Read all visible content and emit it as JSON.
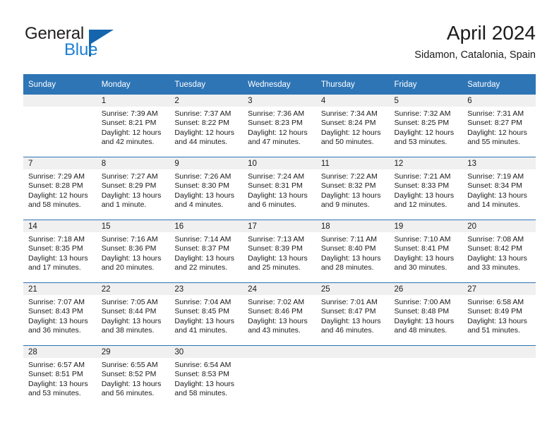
{
  "brand": {
    "name_part1": "General",
    "name_part2": "Blue",
    "logo_icon": "triangle-flag-icon"
  },
  "header": {
    "month_title": "April 2024",
    "location": "Sidamon, Catalonia, Spain"
  },
  "colors": {
    "header_blue": "#2e75b6",
    "brand_blue": "#1c7fd4",
    "daynum_band": "#f0f0f0"
  },
  "weekday_headers": [
    "Sunday",
    "Monday",
    "Tuesday",
    "Wednesday",
    "Thursday",
    "Friday",
    "Saturday"
  ],
  "weeks": [
    [
      {
        "day": "",
        "empty": true,
        "l1": "",
        "l2": "",
        "l3": "",
        "l4": ""
      },
      {
        "day": "1",
        "l1": "Sunrise: 7:39 AM",
        "l2": "Sunset: 8:21 PM",
        "l3": "Daylight: 12 hours",
        "l4": "and 42 minutes."
      },
      {
        "day": "2",
        "l1": "Sunrise: 7:37 AM",
        "l2": "Sunset: 8:22 PM",
        "l3": "Daylight: 12 hours",
        "l4": "and 44 minutes."
      },
      {
        "day": "3",
        "l1": "Sunrise: 7:36 AM",
        "l2": "Sunset: 8:23 PM",
        "l3": "Daylight: 12 hours",
        "l4": "and 47 minutes."
      },
      {
        "day": "4",
        "l1": "Sunrise: 7:34 AM",
        "l2": "Sunset: 8:24 PM",
        "l3": "Daylight: 12 hours",
        "l4": "and 50 minutes."
      },
      {
        "day": "5",
        "l1": "Sunrise: 7:32 AM",
        "l2": "Sunset: 8:25 PM",
        "l3": "Daylight: 12 hours",
        "l4": "and 53 minutes."
      },
      {
        "day": "6",
        "l1": "Sunrise: 7:31 AM",
        "l2": "Sunset: 8:27 PM",
        "l3": "Daylight: 12 hours",
        "l4": "and 55 minutes."
      }
    ],
    [
      {
        "day": "7",
        "l1": "Sunrise: 7:29 AM",
        "l2": "Sunset: 8:28 PM",
        "l3": "Daylight: 12 hours",
        "l4": "and 58 minutes."
      },
      {
        "day": "8",
        "l1": "Sunrise: 7:27 AM",
        "l2": "Sunset: 8:29 PM",
        "l3": "Daylight: 13 hours",
        "l4": "and 1 minute."
      },
      {
        "day": "9",
        "l1": "Sunrise: 7:26 AM",
        "l2": "Sunset: 8:30 PM",
        "l3": "Daylight: 13 hours",
        "l4": "and 4 minutes."
      },
      {
        "day": "10",
        "l1": "Sunrise: 7:24 AM",
        "l2": "Sunset: 8:31 PM",
        "l3": "Daylight: 13 hours",
        "l4": "and 6 minutes."
      },
      {
        "day": "11",
        "l1": "Sunrise: 7:22 AM",
        "l2": "Sunset: 8:32 PM",
        "l3": "Daylight: 13 hours",
        "l4": "and 9 minutes."
      },
      {
        "day": "12",
        "l1": "Sunrise: 7:21 AM",
        "l2": "Sunset: 8:33 PM",
        "l3": "Daylight: 13 hours",
        "l4": "and 12 minutes."
      },
      {
        "day": "13",
        "l1": "Sunrise: 7:19 AM",
        "l2": "Sunset: 8:34 PM",
        "l3": "Daylight: 13 hours",
        "l4": "and 14 minutes."
      }
    ],
    [
      {
        "day": "14",
        "l1": "Sunrise: 7:18 AM",
        "l2": "Sunset: 8:35 PM",
        "l3": "Daylight: 13 hours",
        "l4": "and 17 minutes."
      },
      {
        "day": "15",
        "l1": "Sunrise: 7:16 AM",
        "l2": "Sunset: 8:36 PM",
        "l3": "Daylight: 13 hours",
        "l4": "and 20 minutes."
      },
      {
        "day": "16",
        "l1": "Sunrise: 7:14 AM",
        "l2": "Sunset: 8:37 PM",
        "l3": "Daylight: 13 hours",
        "l4": "and 22 minutes."
      },
      {
        "day": "17",
        "l1": "Sunrise: 7:13 AM",
        "l2": "Sunset: 8:39 PM",
        "l3": "Daylight: 13 hours",
        "l4": "and 25 minutes."
      },
      {
        "day": "18",
        "l1": "Sunrise: 7:11 AM",
        "l2": "Sunset: 8:40 PM",
        "l3": "Daylight: 13 hours",
        "l4": "and 28 minutes."
      },
      {
        "day": "19",
        "l1": "Sunrise: 7:10 AM",
        "l2": "Sunset: 8:41 PM",
        "l3": "Daylight: 13 hours",
        "l4": "and 30 minutes."
      },
      {
        "day": "20",
        "l1": "Sunrise: 7:08 AM",
        "l2": "Sunset: 8:42 PM",
        "l3": "Daylight: 13 hours",
        "l4": "and 33 minutes."
      }
    ],
    [
      {
        "day": "21",
        "l1": "Sunrise: 7:07 AM",
        "l2": "Sunset: 8:43 PM",
        "l3": "Daylight: 13 hours",
        "l4": "and 36 minutes."
      },
      {
        "day": "22",
        "l1": "Sunrise: 7:05 AM",
        "l2": "Sunset: 8:44 PM",
        "l3": "Daylight: 13 hours",
        "l4": "and 38 minutes."
      },
      {
        "day": "23",
        "l1": "Sunrise: 7:04 AM",
        "l2": "Sunset: 8:45 PM",
        "l3": "Daylight: 13 hours",
        "l4": "and 41 minutes."
      },
      {
        "day": "24",
        "l1": "Sunrise: 7:02 AM",
        "l2": "Sunset: 8:46 PM",
        "l3": "Daylight: 13 hours",
        "l4": "and 43 minutes."
      },
      {
        "day": "25",
        "l1": "Sunrise: 7:01 AM",
        "l2": "Sunset: 8:47 PM",
        "l3": "Daylight: 13 hours",
        "l4": "and 46 minutes."
      },
      {
        "day": "26",
        "l1": "Sunrise: 7:00 AM",
        "l2": "Sunset: 8:48 PM",
        "l3": "Daylight: 13 hours",
        "l4": "and 48 minutes."
      },
      {
        "day": "27",
        "l1": "Sunrise: 6:58 AM",
        "l2": "Sunset: 8:49 PM",
        "l3": "Daylight: 13 hours",
        "l4": "and 51 minutes."
      }
    ],
    [
      {
        "day": "28",
        "l1": "Sunrise: 6:57 AM",
        "l2": "Sunset: 8:51 PM",
        "l3": "Daylight: 13 hours",
        "l4": "and 53 minutes."
      },
      {
        "day": "29",
        "l1": "Sunrise: 6:55 AM",
        "l2": "Sunset: 8:52 PM",
        "l3": "Daylight: 13 hours",
        "l4": "and 56 minutes."
      },
      {
        "day": "30",
        "l1": "Sunrise: 6:54 AM",
        "l2": "Sunset: 8:53 PM",
        "l3": "Daylight: 13 hours",
        "l4": "and 58 minutes."
      },
      {
        "day": "",
        "empty": true,
        "l1": "",
        "l2": "",
        "l3": "",
        "l4": ""
      },
      {
        "day": "",
        "empty": true,
        "l1": "",
        "l2": "",
        "l3": "",
        "l4": ""
      },
      {
        "day": "",
        "empty": true,
        "l1": "",
        "l2": "",
        "l3": "",
        "l4": ""
      },
      {
        "day": "",
        "empty": true,
        "l1": "",
        "l2": "",
        "l3": "",
        "l4": ""
      }
    ]
  ]
}
